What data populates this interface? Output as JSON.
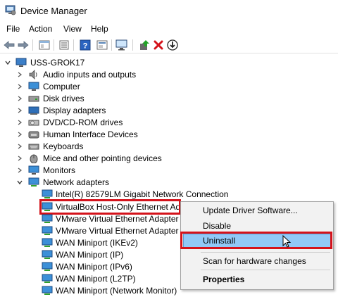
{
  "window": {
    "title": "Device Manager"
  },
  "menu": [
    "File",
    "Action",
    "View",
    "Help"
  ],
  "toolbar": {
    "icons": [
      "back-arrow-icon",
      "forward-arrow-icon",
      "properties-icon",
      "help-icon",
      "monitor-scan-icon",
      "update-driver-icon",
      "uninstall-x-icon",
      "download-icon"
    ],
    "uninstall_color": "#d4131b"
  },
  "tree": {
    "root": "USS-GROK17",
    "categories": [
      "Audio inputs and outputs",
      "Computer",
      "Disk drives",
      "Display adapters",
      "DVD/CD-ROM drives",
      "Human Interface Devices",
      "Keyboards",
      "Mice and other pointing devices",
      "Monitors",
      "Network adapters"
    ],
    "network_adapters": [
      "Intel(R) 82579LM Gigabit Network Connection",
      "VirtualBox Host-Only Ethernet Ada",
      "VMware Virtual Ethernet Adapter fo",
      "VMware Virtual Ethernet Adapter fo",
      "WAN Miniport (IKEv2)",
      "WAN Miniport (IP)",
      "WAN Miniport (IPv6)",
      "WAN Miniport (L2TP)",
      "WAN Miniport (Network Monitor)"
    ]
  },
  "context_menu": {
    "items": [
      "Update Driver Software...",
      "Disable",
      "Uninstall",
      "Scan for hardware changes",
      "Properties"
    ],
    "hovered": "Uninstall"
  },
  "colors": {
    "highlight_red": "#d4131b",
    "menu_hover": "#91c9f7"
  }
}
